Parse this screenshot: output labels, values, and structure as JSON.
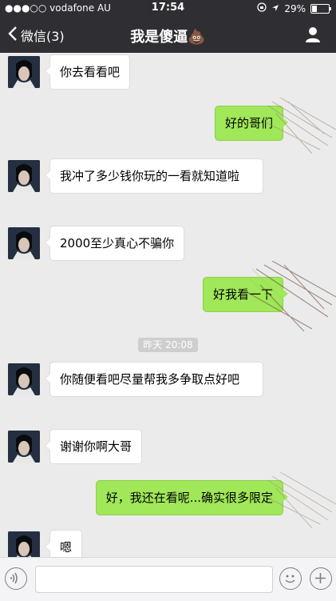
{
  "status_bar": {
    "carrier": "●●●○○ vodafone AU",
    "time": "17:54",
    "battery": "29%",
    "battery_level": 0.29
  },
  "nav": {
    "back_label": "微信(3)",
    "title": "我是傻逼",
    "title_emoji": "💩"
  },
  "messages": [
    {
      "side": "in",
      "text": "你去看看吧"
    },
    {
      "side": "out",
      "text": "好的哥们"
    },
    {
      "side": "in",
      "text": "我冲了多少钱你玩的一看就知道啦"
    },
    {
      "side": "in",
      "text": "2000至少真心不骗你"
    },
    {
      "side": "out",
      "text": "好我看一下"
    },
    {
      "side": "in",
      "text": "你随便看吧尽量帮我多争取点好吧"
    },
    {
      "side": "in",
      "text": "谢谢你啊大哥"
    },
    {
      "side": "out",
      "text": "好，我还在看呢...确实很多限定"
    },
    {
      "side": "in",
      "text": "嗯"
    }
  ],
  "timestamp": "昨天 20:08",
  "colors": {
    "nav_bg": "#2e2e33",
    "chat_bg": "#ebebeb",
    "outgoing_bubble": "#a0e759",
    "incoming_bubble": "#ffffff"
  }
}
